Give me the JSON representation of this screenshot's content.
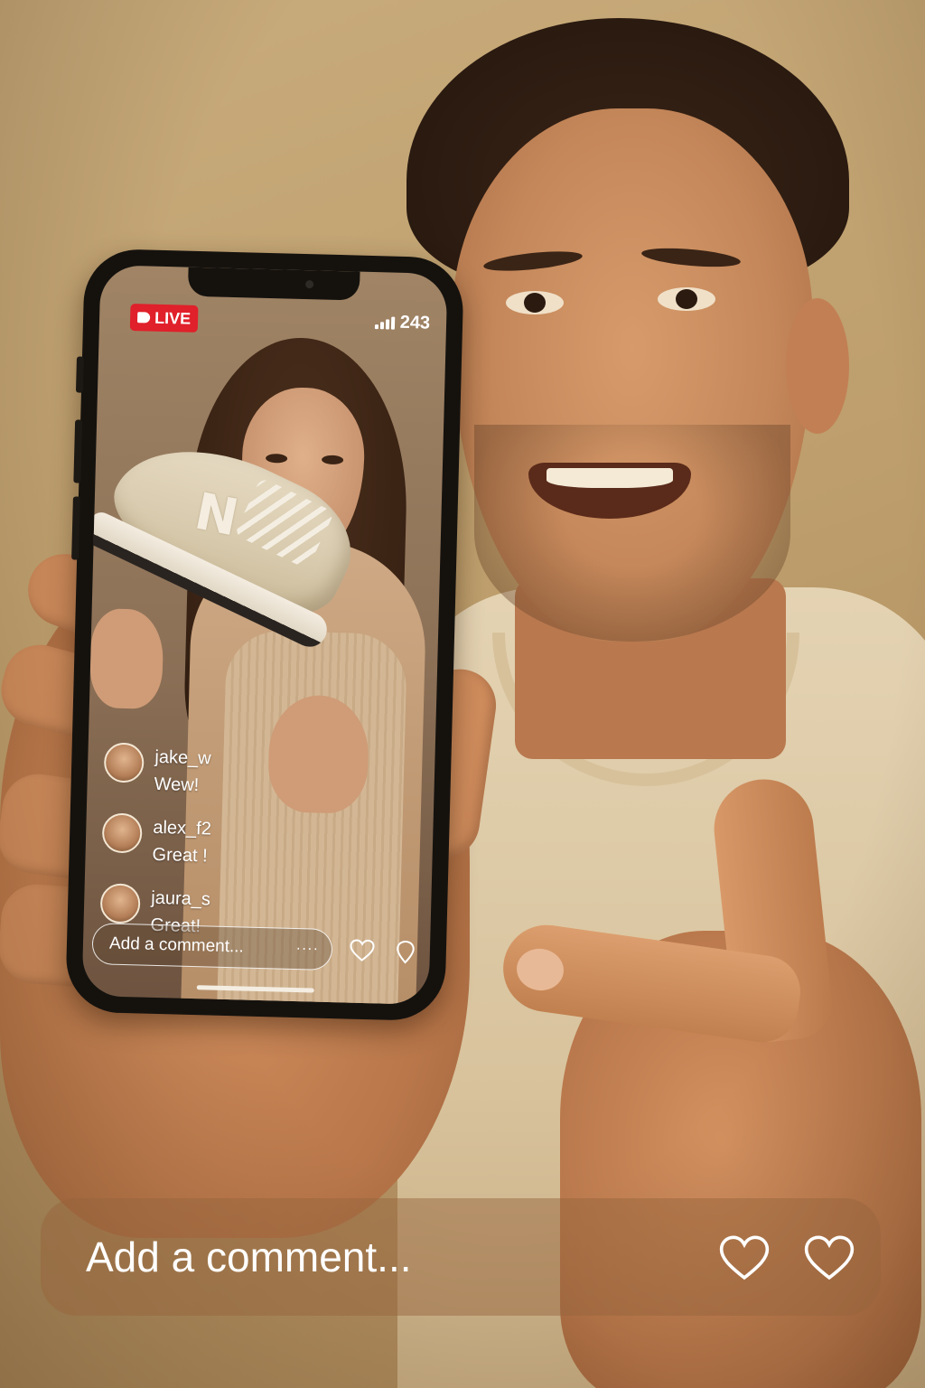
{
  "live": {
    "badge_label": "LIVE",
    "viewer_count": "243",
    "accent_color": "#e0202a"
  },
  "comments": [
    {
      "username": "jake_w",
      "message": "Wew!"
    },
    {
      "username": "alex_f2",
      "message": "Great !"
    },
    {
      "username": "jaura_s",
      "message": "Great!"
    }
  ],
  "screen_bottom": {
    "input_placeholder": "Add a comment...",
    "more_label": "····",
    "icons": [
      "heart-outline-icon",
      "share-icon"
    ]
  },
  "bottom_bar": {
    "input_placeholder": "Add a comment...",
    "icons": [
      "heart-outline-icon",
      "heart-outline-icon"
    ]
  },
  "icons": {
    "live": "live-broadcast-icon",
    "viewers": "signal-bars-icon",
    "shoe_logo": "N"
  }
}
